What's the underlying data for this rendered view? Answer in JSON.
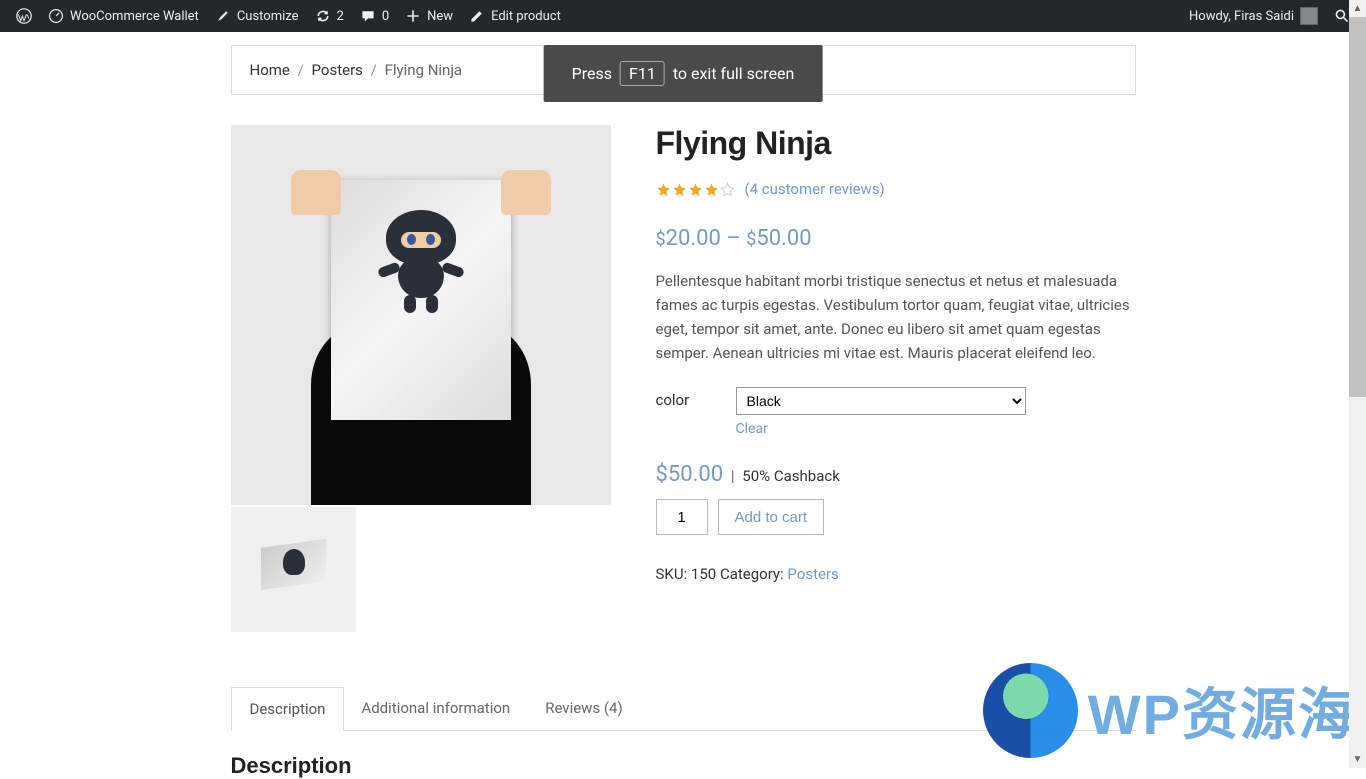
{
  "adminBar": {
    "siteName": "WooCommerce Wallet",
    "customize": "Customize",
    "updates": "2",
    "comments": "0",
    "new": "New",
    "editProduct": "Edit product",
    "howdy": "Howdy, Firas Saidi"
  },
  "fullscreen": {
    "press": "Press",
    "key": "F11",
    "exit": "to exit full screen"
  },
  "breadcrumb": {
    "home": "Home",
    "category": "Posters",
    "current": "Flying Ninja"
  },
  "product": {
    "title": "Flying Ninja",
    "reviewsText": "(4 customer reviews)",
    "rating": 4,
    "priceMin": "20.00",
    "priceMax": "50.00",
    "currency": "$",
    "priceSep": "–",
    "description": "Pellentesque habitant morbi tristique senectus et netus et malesuada fames ac turpis egestas. Vestibulum tortor quam, feugiat vitae, ultricies eget, tempor sit amet, ante. Donec eu libero sit amet quam egestas semper. Aenean ultricies mi vitae est. Mauris placerat eleifend leo.",
    "variation": {
      "label": "color",
      "selected": "Black",
      "clear": "Clear"
    },
    "selectedPrice": "50.00",
    "cashback": "50% Cashback",
    "quantity": "1",
    "addToCart": "Add to cart",
    "skuLabel": "SKU:",
    "sku": "150",
    "categoryLabel": "Category:",
    "category": "Posters"
  },
  "tabs": {
    "description": "Description",
    "additional": "Additional information",
    "reviews": "Reviews (4)"
  },
  "tabContent": {
    "heading": "Description"
  },
  "watermark": {
    "text": "WP资源海"
  }
}
